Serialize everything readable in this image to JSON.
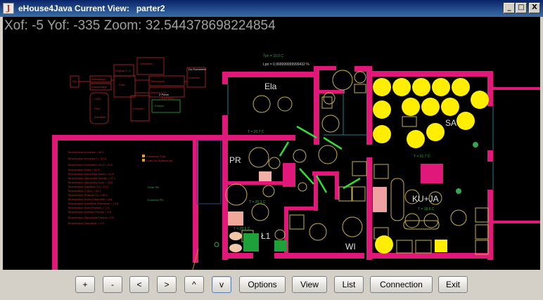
{
  "window": {
    "title": "eHouse4Java Current View:   parter2",
    "controls": {
      "minimize": "_",
      "maximize": "□",
      "close": "X"
    }
  },
  "status": {
    "xof_label": "Xof:",
    "xof_value": "-5",
    "yof_label": "Yof:",
    "yof_value": "-335",
    "zoom_label": "Zoom:",
    "zoom_value": "32.544378698224854"
  },
  "plan": {
    "rooms": [
      "Ela",
      "PR",
      "SA",
      "KU+JA",
      "Ł1",
      "WI"
    ],
    "temperatures": {
      "tpn": "Tpn = 10.0 C",
      "lpn": "Lpn = 0.999999999999432 %",
      "ela": "T = 20.7 C",
      "sa": "T = 21.7 C",
      "pr": "T = 20.3 C",
      "kuja": "T = 18.8 C",
      "l1": "T = 20.6 C"
    },
    "left_panel": {
      "items": [
        "Temperatura Kominka = 48.4",
        "Temperatura Kominka 2 = 47.5",
        "Temperatura Kominka C.W.U = 20.6",
        "Temperatura Kotla = 45.3",
        "Temperatura Zasobnika Dolna = 24.5",
        "Temperatura Zasobnika Srodek = 27.1",
        "Temperatura Zasobnika Gora = 33.6",
        "Temperatura Zasilania Co = 44.2",
        "Temperatura C.W.U = 34.1",
        "Temperatura Powrotu Co = 35.0",
        "Temperatura Solar Pobieranie = 6.8",
        "Temperatura Kolektora Solarnego = 12.8",
        "Temperatura Solar Powrotu = 7.4",
        "Temperatura Kolektor Pompy = 9.6",
        "Temperatura Zasobnika Pompa = 6.5",
        "Temperatura Otoczenia = 3.9"
      ],
      "legend": [
        "Zalaczony Tryb",
        "Czas Do Wylaczenia"
      ],
      "status_labels": [
        "Solar Pl0",
        "Kominek Pl0"
      ]
    },
    "diagram": {
      "boxes": [
        "Ela",
        "Wentylacja",
        "Rekuperator",
        "Prad",
        "Wyjscie C.O.",
        "Cyrkulacja",
        "Sterowanie",
        "Wejscie C.O.",
        "Do Rozdzielni",
        "Zasilanie",
        "Pompa",
        "Kominek",
        "Z Pieca",
        "Do Pieca",
        "Piec",
        "CWU",
        "Zasobnik"
      ]
    },
    "colors": {
      "wall": "#e0187a",
      "light_on": "#ffee00",
      "temp_text": "#2fa84f",
      "furniture": "#c8b04a",
      "door": "#33dd33"
    }
  },
  "toolbar": {
    "buttons": [
      "+",
      "-",
      "<",
      ">",
      "^",
      "v",
      "Options",
      "View",
      "List",
      "Connection",
      "Exit"
    ]
  }
}
